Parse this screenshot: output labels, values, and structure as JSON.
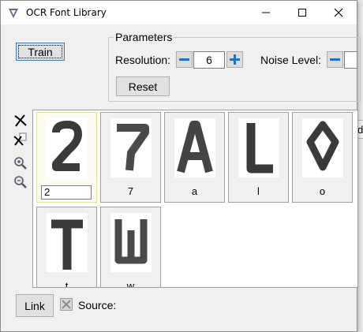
{
  "window": {
    "title": "OCR Font Library"
  },
  "background": {
    "tab_text": "d"
  },
  "toolbar": {
    "train_label": "Train"
  },
  "parameters": {
    "legend": "Parameters",
    "resolution_label": "Resolution:",
    "resolution_value": "6",
    "noise_label": "Noise Level:",
    "noise_value": "",
    "reset_label": "Reset"
  },
  "glyphs": [
    {
      "char": "2",
      "label": "2",
      "selected": true
    },
    {
      "char": "7",
      "label": "7",
      "selected": false
    },
    {
      "char": "A",
      "label": "a",
      "selected": false
    },
    {
      "char": "L",
      "label": "l",
      "selected": false
    },
    {
      "char": "O",
      "label": "o",
      "selected": false
    },
    {
      "char": "T",
      "label": "t",
      "selected": false
    },
    {
      "char": "W",
      "label": "w",
      "selected": false
    }
  ],
  "bottom": {
    "link_label": "Link",
    "source_label": "Source:",
    "source_value": ""
  },
  "icons": [
    "app-icon",
    "minimize-icon",
    "maximize-icon",
    "close-icon",
    "minus-icon",
    "plus-icon",
    "delete-icon",
    "delete-copy-icon",
    "zoom-in-icon",
    "zoom-out-icon",
    "checkbox-disabled-icon"
  ],
  "colors": {
    "accent_blue": "#1e73c8",
    "selection_border": "#e8e39a",
    "glyph_ink": "#3a3a3a"
  }
}
